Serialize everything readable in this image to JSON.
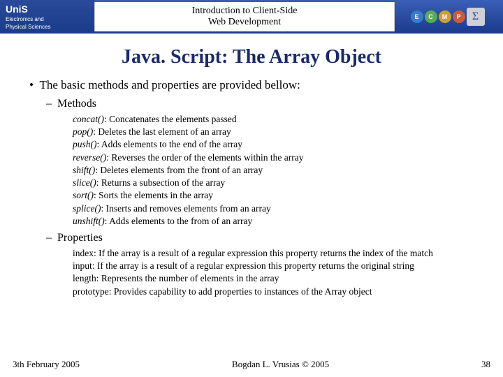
{
  "header": {
    "logo_top": "UniS",
    "logo_sub1": "Electronics and",
    "logo_sub2": "Physical Sciences",
    "title_line1": "Introduction to Client-Side",
    "title_line2": "Web Development",
    "icons": {
      "e": "E",
      "c": "C",
      "m": "M",
      "p": "P",
      "sigma": "Σ"
    }
  },
  "slide": {
    "title": "Java. Script: The Array Object",
    "intro": "The basic methods and properties are provided bellow:",
    "methods_label": "Methods",
    "properties_label": "Properties",
    "methods": [
      {
        "name": "concat()",
        "desc": ": Concatenates the elements passed"
      },
      {
        "name": "pop()",
        "desc": ": Deletes the last element of an array"
      },
      {
        "name": "push()",
        "desc": ": Adds elements to the end of the array"
      },
      {
        "name": "reverse()",
        "desc": ": Reverses the order of the elements within the array"
      },
      {
        "name": "shift()",
        "desc": ": Deletes elements from the front of an array"
      },
      {
        "name": "slice()",
        "desc": ": Returns a subsection of the array"
      },
      {
        "name": "sort()",
        "desc": ": Sorts the elements in the array"
      },
      {
        "name": "splice()",
        "desc": ": Inserts and removes elements from an array"
      },
      {
        "name": "unshift()",
        "desc": ": Adds elements to the from of an array"
      }
    ],
    "properties": [
      {
        "name": "index",
        "desc": ": If the array is a result of a regular expression this property returns the index of the match"
      },
      {
        "name": "input",
        "desc": ": If the array is a result of a regular expression this property returns the original string"
      },
      {
        "name": "length",
        "desc": ": Represents the number of elements in the array"
      },
      {
        "name": "prototype",
        "desc": ": Provides capability to add properties to instances of the Array object"
      }
    ]
  },
  "footer": {
    "date": "3th February 2005",
    "author": "Bogdan L. Vrusias © 2005",
    "page": "38"
  }
}
